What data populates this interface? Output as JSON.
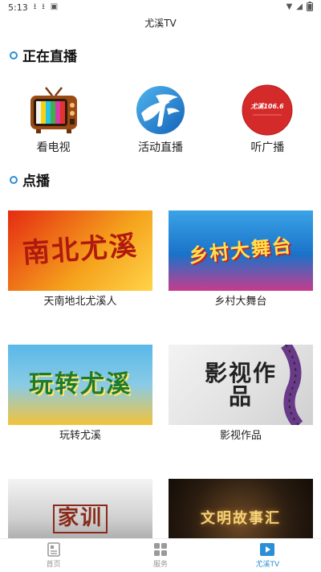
{
  "status_bar": {
    "time": "5:13"
  },
  "app": {
    "title": "尤溪TV"
  },
  "live": {
    "heading": "正在直播",
    "items": [
      {
        "label": "看电视",
        "icon": "tv-icon"
      },
      {
        "label": "活动直播",
        "icon": "activity-live-icon"
      },
      {
        "label": "听广播",
        "icon": "radio-icon",
        "badge": "尤溪106.6"
      }
    ]
  },
  "vod": {
    "heading": "点播",
    "items": [
      {
        "label": "天南地北尤溪人",
        "thumb_text": "南北尤溪"
      },
      {
        "label": "乡村大舞台",
        "thumb_text": "乡村大舞台"
      },
      {
        "label": "玩转尤溪",
        "thumb_text": "玩转尤溪"
      },
      {
        "label": "影视作品",
        "thumb_text": "影视作品"
      },
      {
        "label": "",
        "thumb_text": "家训"
      },
      {
        "label": "",
        "thumb_text": "文明故事汇"
      }
    ]
  },
  "nav": {
    "items": [
      {
        "label": "首页",
        "icon": "home-icon"
      },
      {
        "label": "服务",
        "icon": "grid-icon"
      },
      {
        "label": "尤溪TV",
        "icon": "video-icon",
        "active": true
      }
    ]
  },
  "colors": {
    "accent": "#2a8fd6",
    "radio_red": "#d42a2a"
  }
}
